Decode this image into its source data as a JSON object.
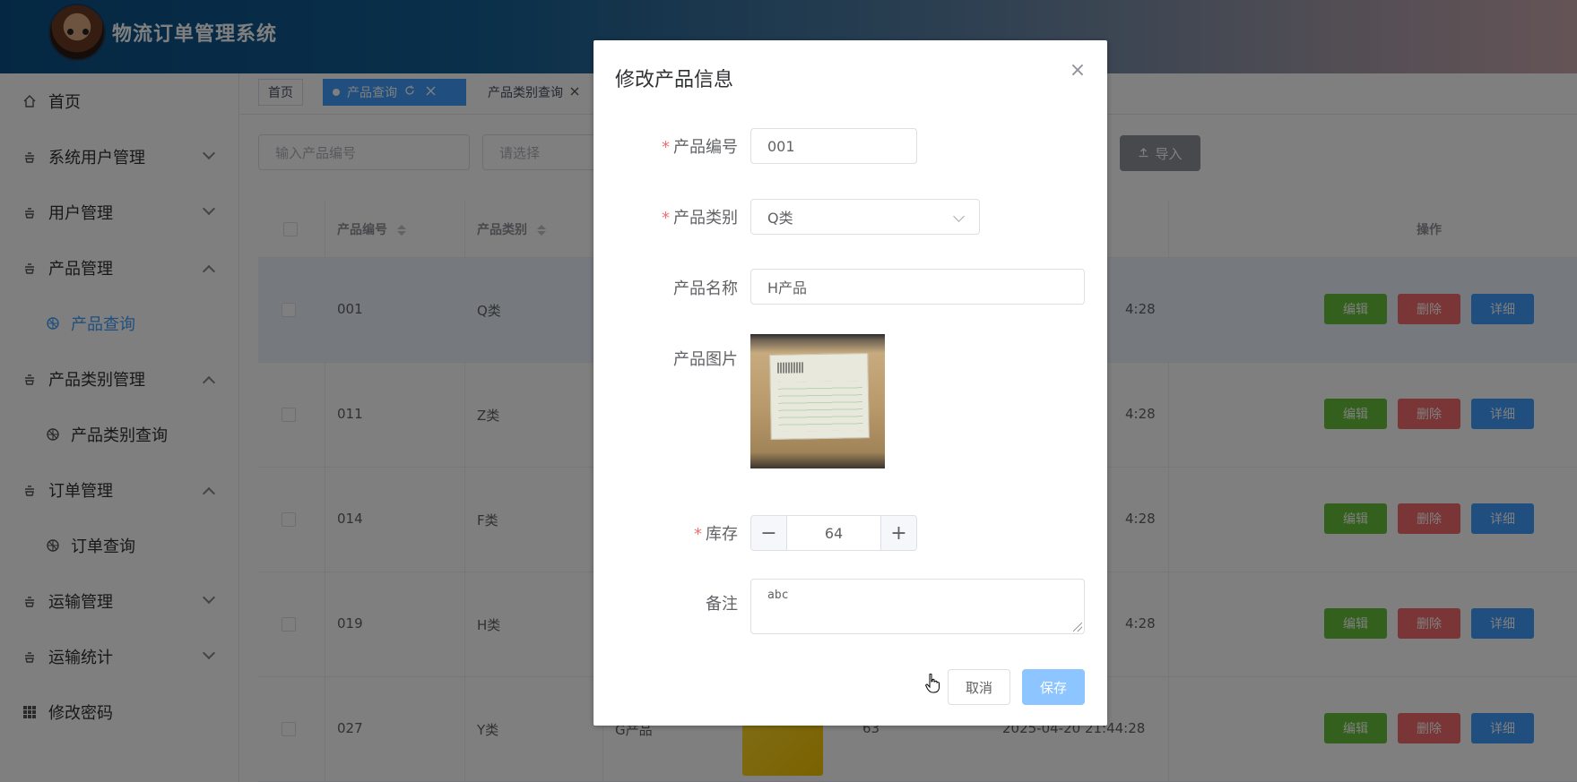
{
  "app": {
    "title": "物流订单管理系统"
  },
  "sidebar": {
    "items": [
      {
        "label": "首页",
        "icon": "home-icon"
      },
      {
        "label": "系统用户管理",
        "icon": "user-mgmt-icon"
      },
      {
        "label": "用户管理",
        "icon": "user-mgmt-icon"
      },
      {
        "label": "产品管理",
        "icon": "product-icon"
      },
      {
        "label": "产品查询",
        "icon": "search-icon",
        "active": true
      },
      {
        "label": "产品类别管理",
        "icon": "category-icon"
      },
      {
        "label": "产品类别查询",
        "icon": "search-icon"
      },
      {
        "label": "订单管理",
        "icon": "order-icon"
      },
      {
        "label": "订单查询",
        "icon": "search-icon"
      },
      {
        "label": "运输管理",
        "icon": "transport-icon"
      },
      {
        "label": "运输统计",
        "icon": "stats-icon"
      },
      {
        "label": "修改密码",
        "icon": "grid-icon"
      }
    ]
  },
  "tabs": [
    {
      "label": "首页"
    },
    {
      "label": "产品查询",
      "active": true
    },
    {
      "label": "产品类别查询"
    }
  ],
  "filters": {
    "product_no_placeholder": "输入产品编号",
    "select_placeholder": "请选择",
    "import_label": "导入"
  },
  "table": {
    "headers": {
      "product_no": "产品编号",
      "category": "产品类别",
      "actions": "操作"
    },
    "rows": [
      {
        "product_no": "001",
        "category": "Q类",
        "time": "4:28"
      },
      {
        "product_no": "011",
        "category": "Z类",
        "time": "4:28"
      },
      {
        "product_no": "014",
        "category": "F类",
        "time": "4:28"
      },
      {
        "product_no": "019",
        "category": "H类",
        "time": "4:28"
      },
      {
        "product_no": "027",
        "category": "Y类",
        "name": "G产品",
        "stock": "63",
        "time": "2025-04-20 21:44:28"
      }
    ],
    "row_actions": {
      "edit": "编辑",
      "delete": "删除",
      "detail": "详细"
    }
  },
  "dialog": {
    "title": "修改产品信息",
    "fields": {
      "product_no": {
        "label": "产品编号",
        "value": "001",
        "required": true
      },
      "category": {
        "label": "产品类别",
        "value": "Q类",
        "required": true
      },
      "name": {
        "label": "产品名称",
        "value": "H产品"
      },
      "image": {
        "label": "产品图片"
      },
      "stock": {
        "label": "库存",
        "value": "64",
        "required": true
      },
      "remark": {
        "label": "备注",
        "value": "abc"
      }
    },
    "cancel_label": "取消",
    "save_label": "保存",
    "required_mark": "*",
    "close_glyph": "×",
    "minus_glyph": "−",
    "plus_glyph": "+"
  },
  "colors": {
    "primary": "#409eff",
    "success": "#67c23a",
    "danger": "#f56c6c"
  }
}
